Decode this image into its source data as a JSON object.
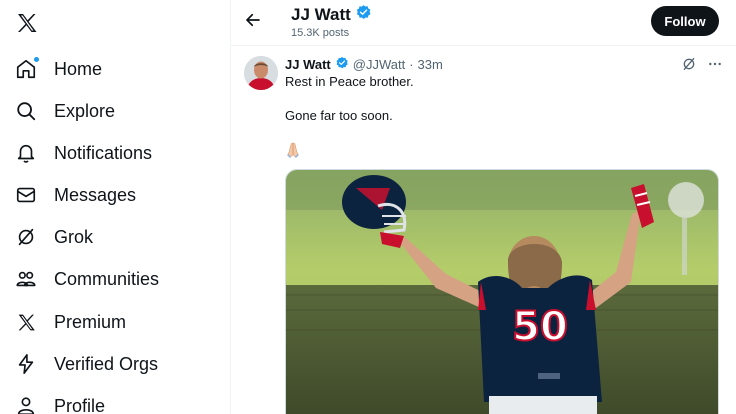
{
  "nav": {
    "items": [
      {
        "label": "Home",
        "icon": "home-icon"
      },
      {
        "label": "Explore",
        "icon": "search-icon"
      },
      {
        "label": "Notifications",
        "icon": "bell-icon"
      },
      {
        "label": "Messages",
        "icon": "envelope-icon"
      },
      {
        "label": "Grok",
        "icon": "grok-icon"
      },
      {
        "label": "Communities",
        "icon": "people-icon"
      },
      {
        "label": "Premium",
        "icon": "x-logo-icon"
      },
      {
        "label": "Verified Orgs",
        "icon": "lightning-icon"
      },
      {
        "label": "Profile",
        "icon": "person-icon"
      }
    ]
  },
  "header": {
    "title": "JJ Watt",
    "posts_count": "15.3K posts",
    "follow_label": "Follow"
  },
  "post": {
    "name": "JJ Watt",
    "handle": "@JJWatt",
    "separator": "·",
    "time": "33m",
    "line1": "Rest in Peace brother.",
    "line2": "Gone far too soon.",
    "emoji": "praying-hands-emoji",
    "jersey_number": "50"
  },
  "colors": {
    "accent": "#1d9bf0",
    "text": "#0f1419",
    "muted": "#536471",
    "jersey": "#0c2340",
    "jersey_red": "#c8102e"
  }
}
